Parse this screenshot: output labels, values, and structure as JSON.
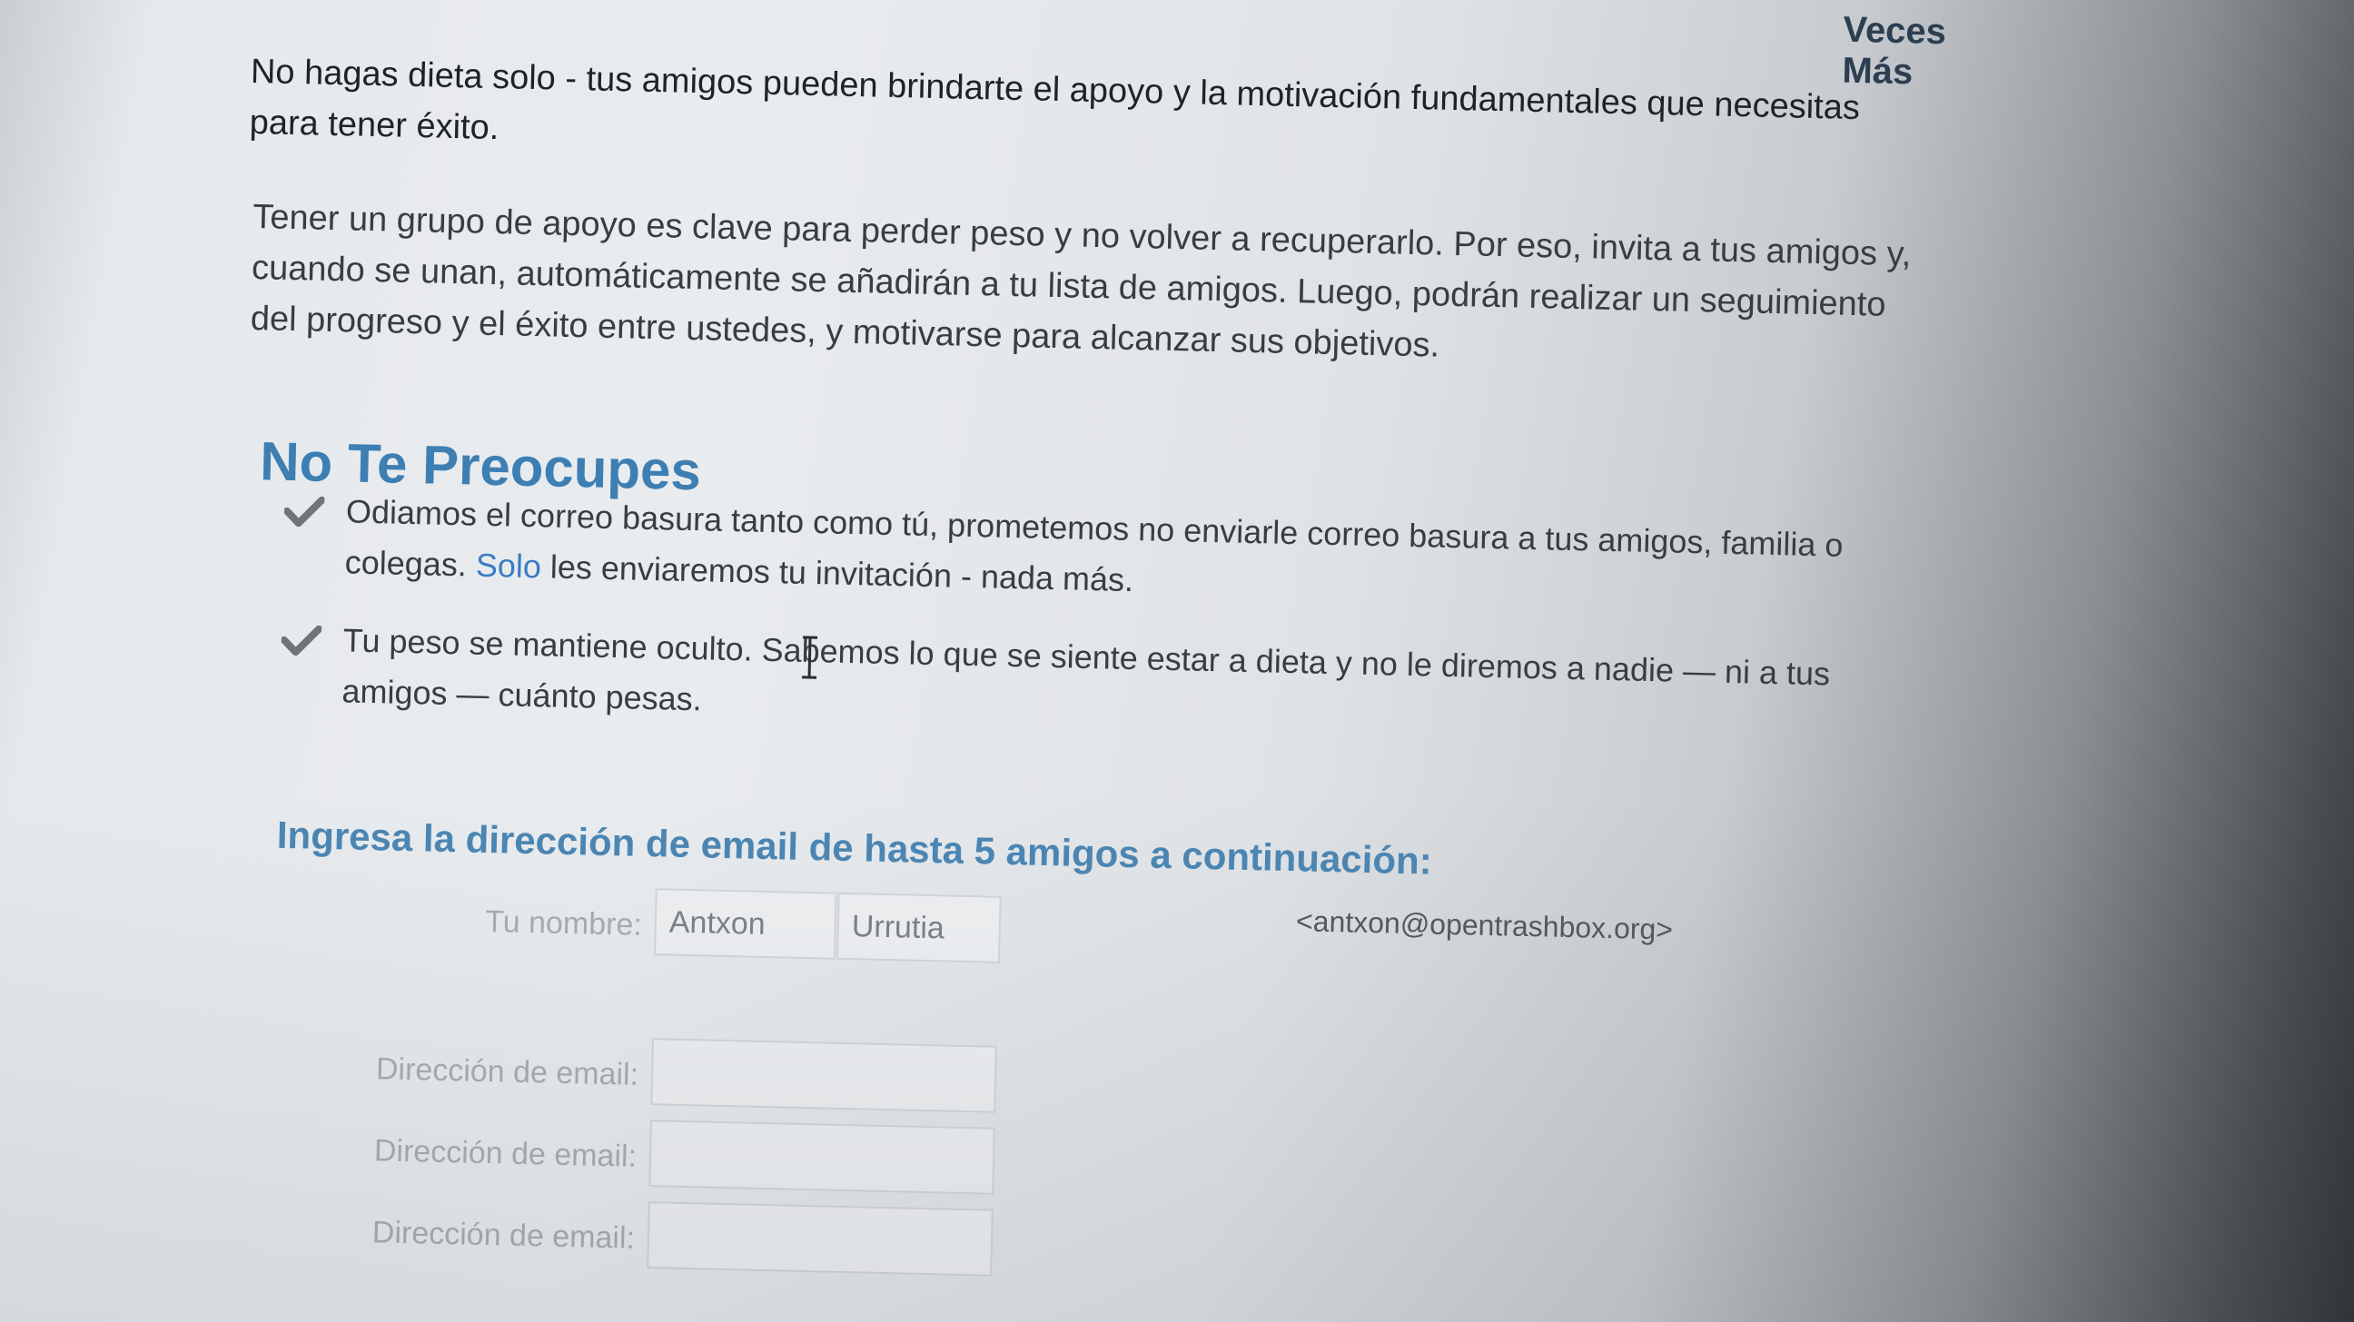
{
  "header": {
    "fragment": "Veces Más"
  },
  "intro": {
    "paragraph_1": "No hagas dieta solo - tus amigos pueden brindarte el apoyo y la motivación fundamentales que necesitas para tener éxito.",
    "paragraph_2": "Tener un grupo de apoyo es clave para perder peso y no volver a recuperarlo. Por eso, invita a tus amigos y, cuando se unan, automáticamente se añadirán a tu lista de amigos. Luego, podrán realizar un seguimiento del progreso y el éxito entre ustedes, y motivarse para alcanzar sus objetivos."
  },
  "reassurance": {
    "title": "No Te Preocupes",
    "items": [
      {
        "text_before": "Odiamos el correo basura tanto como tú, prometemos no enviarle correo basura a tus amigos, familia o colegas. ",
        "link": "Solo",
        "text_after": " les enviaremos tu invitación - nada más."
      },
      {
        "text": "Tu peso se mantiene oculto. Sabemos lo que se siente estar a dieta y no le diremos a nadie — ni a tus amigos — cuánto pesas."
      }
    ]
  },
  "invite_form": {
    "title": "Ingresa la dirección de email de hasta 5 amigos a continuación:",
    "name_label": "Tu nombre:",
    "first_name": "Antxon",
    "last_name": "Urrutia",
    "own_email": "<antxon@opentrashbox.org>",
    "email_label": "Dirección de email:",
    "email_rows": [
      {
        "label": "Dirección de email:",
        "value": ""
      },
      {
        "label": "Dirección de email:",
        "value": ""
      },
      {
        "label": "Dirección de email:",
        "value": ""
      }
    ]
  },
  "colors": {
    "heading": "#3d7fb3",
    "link": "#3a7cc0",
    "check": "#6e7478",
    "text": "#3a3d40"
  },
  "icons": {
    "bullet": "check-icon",
    "cursor": "text-cursor-icon"
  }
}
